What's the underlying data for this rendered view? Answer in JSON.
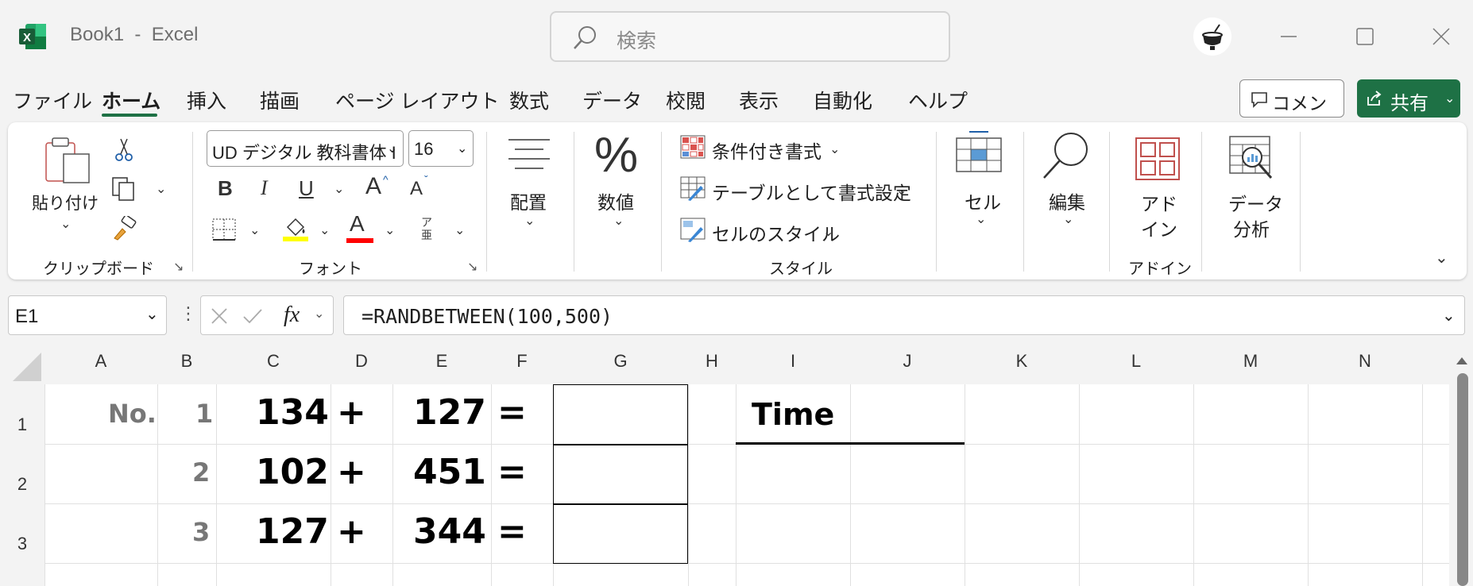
{
  "window": {
    "app_title": "Book1  -  Excel",
    "search_placeholder": "検索"
  },
  "menu": {
    "tabs": [
      "ファイル",
      "ホーム",
      "挿入",
      "描画",
      "ページ レイアウト",
      "数式",
      "データ",
      "校閲",
      "表示",
      "自動化",
      "ヘルプ"
    ],
    "comment_label": "コメント",
    "share_label": "共有"
  },
  "ribbon": {
    "clipboard": {
      "paste_label": "貼り付け",
      "group_label": "クリップボード"
    },
    "font": {
      "font_name": "UD デジタル 教科書体 I",
      "font_size": "16",
      "bold": "B",
      "italic": "I",
      "underline": "U",
      "grow": "A",
      "shrink": "A",
      "color_letter": "A",
      "phonetic": "ア亜",
      "group_label": "フォント"
    },
    "alignment_label": "配置",
    "number_label": "数値",
    "number_symbol": "%",
    "styles": {
      "conditional": "条件付き書式",
      "table": "テーブルとして書式設定",
      "cell_styles": "セルのスタイル",
      "group_label": "スタイル"
    },
    "cells_label": "セル",
    "editing_label": "編集",
    "addins": {
      "label_line1": "アド",
      "label_line2": "イン",
      "group_label": "アドイン"
    },
    "analysis": {
      "label_line1": "データ",
      "label_line2": "分析"
    }
  },
  "formula_bar": {
    "name_box": "E1",
    "fx": "fx",
    "formula": "=RANDBETWEEN(100,500)"
  },
  "sheet": {
    "columns": [
      "A",
      "B",
      "C",
      "D",
      "E",
      "F",
      "G",
      "H",
      "I",
      "J",
      "K",
      "L",
      "M",
      "N"
    ],
    "rows": [
      "1",
      "2",
      "3"
    ],
    "header_no": "No.",
    "time_label": "Time",
    "problems": [
      {
        "no": "1",
        "a": "134",
        "op": "+",
        "b": "127",
        "eq": "="
      },
      {
        "no": "2",
        "a": "102",
        "op": "+",
        "b": "451",
        "eq": "="
      },
      {
        "no": "3",
        "a": "127",
        "op": "+",
        "b": "344",
        "eq": "="
      }
    ]
  },
  "colors": {
    "excel_green": "#1e7145",
    "fill_yellow": "#ffff00",
    "font_red": "#ff0000"
  }
}
